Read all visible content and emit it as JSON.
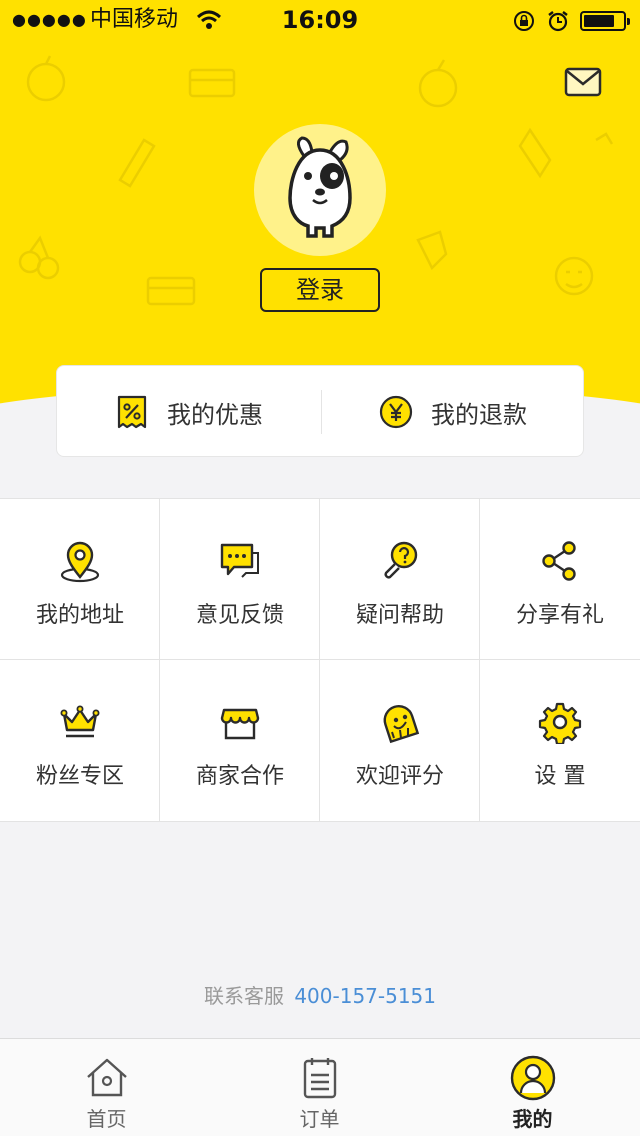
{
  "status_bar": {
    "signal": "●●●●●",
    "carrier": "中国移动",
    "time": "16:09",
    "battery_level": 0.8
  },
  "header": {
    "background_color": "#ffe100",
    "mail_icon": "mail-icon",
    "avatar_icon": "dog-mascot-icon",
    "login_label": "登录"
  },
  "quick_actions": [
    {
      "label": "我的优惠",
      "icon": "coupon-icon"
    },
    {
      "label": "我的退款",
      "icon": "yen-coin-icon"
    }
  ],
  "grid": [
    {
      "label": "我的地址",
      "icon": "location-pin-icon"
    },
    {
      "label": "意见反馈",
      "icon": "chat-bubble-icon"
    },
    {
      "label": "疑问帮助",
      "icon": "help-lightbulb-icon"
    },
    {
      "label": "分享有礼",
      "icon": "share-icon"
    },
    {
      "label": "粉丝专区",
      "icon": "crown-icon"
    },
    {
      "label": "商家合作",
      "icon": "storefront-icon"
    },
    {
      "label": "欢迎评分",
      "icon": "rating-mascot-icon"
    },
    {
      "label": "设 置",
      "icon": "gear-icon"
    }
  ],
  "service": {
    "label": "联系客服",
    "phone": "400-157-5151"
  },
  "tabbar": [
    {
      "label": "首页",
      "icon": "home-icon",
      "active": false
    },
    {
      "label": "订单",
      "icon": "order-list-icon",
      "active": false
    },
    {
      "label": "我的",
      "icon": "profile-icon",
      "active": true
    }
  ],
  "colors": {
    "accent": "#ffe100",
    "link": "#4a8ed6",
    "icon_stroke": "#2b2b2b"
  }
}
